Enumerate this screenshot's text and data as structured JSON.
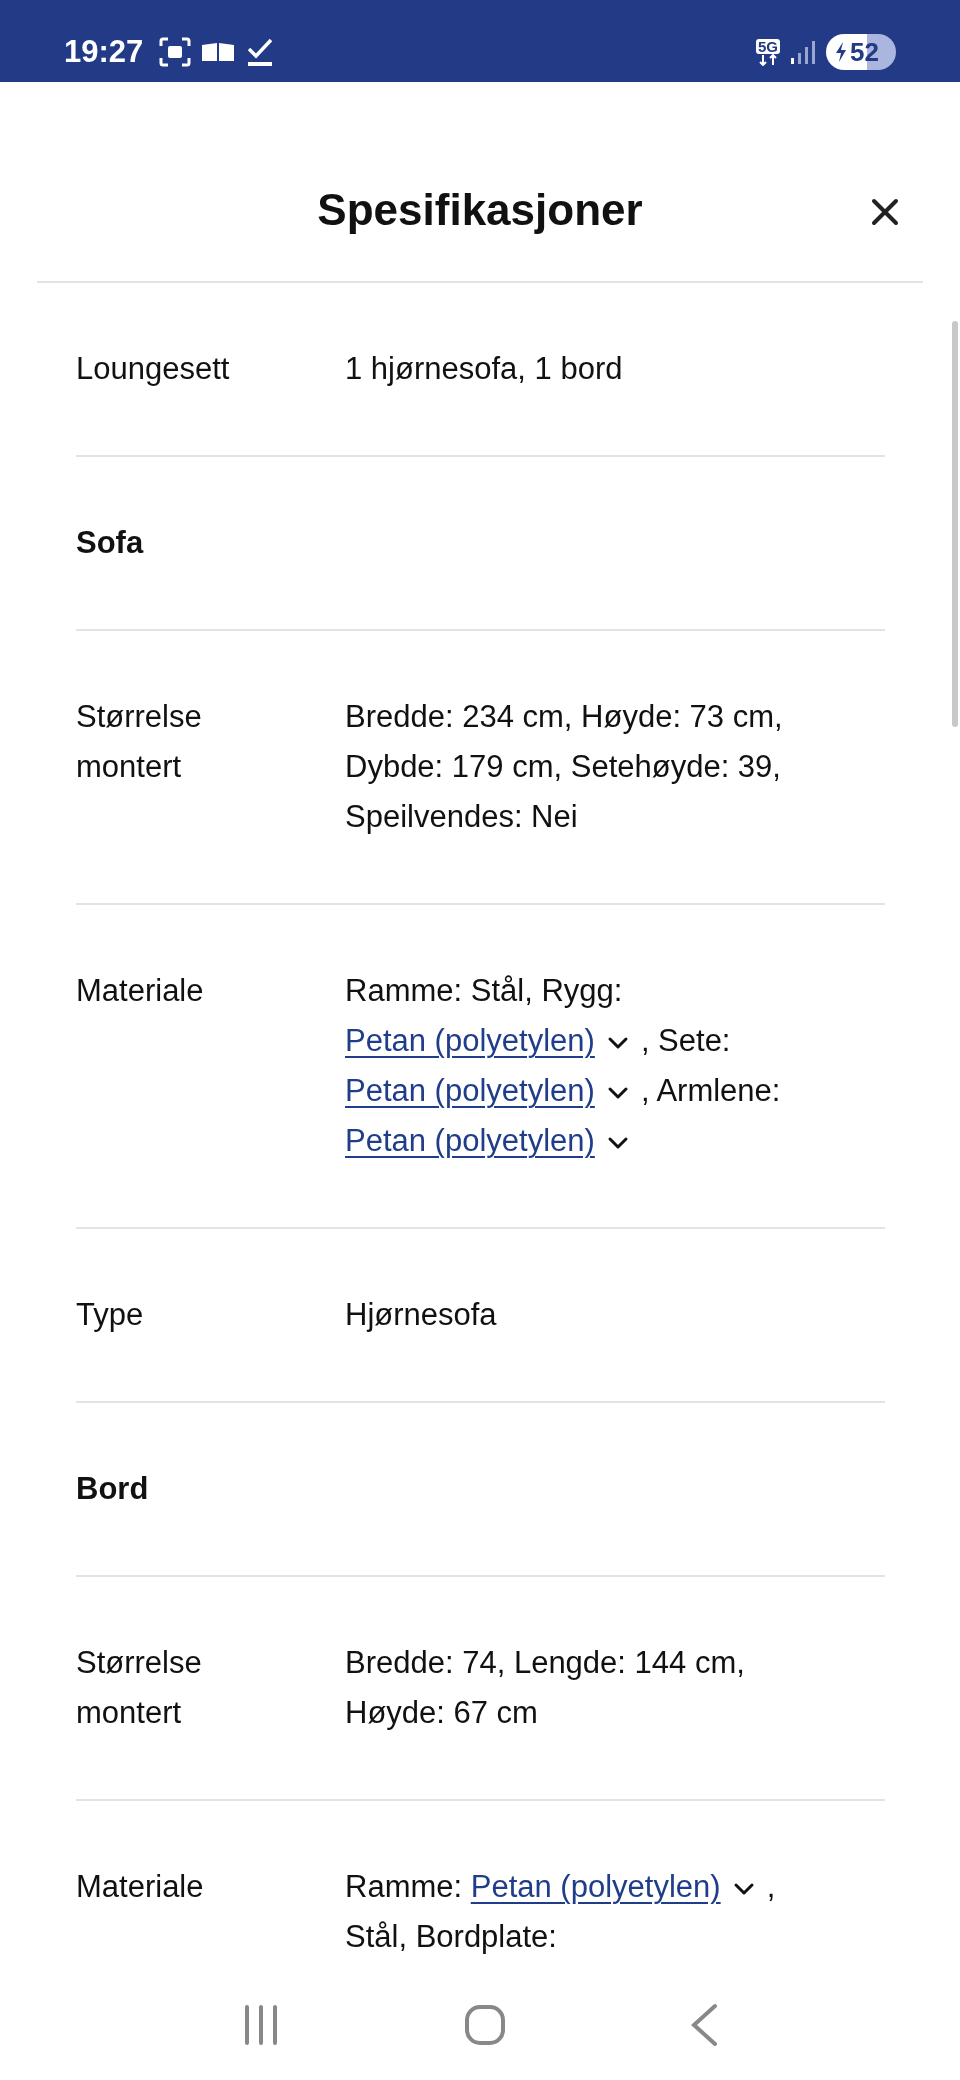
{
  "status_bar": {
    "time": "19:27",
    "network": "5G",
    "battery": "52"
  },
  "dialog": {
    "title": "Spesifikasjoner"
  },
  "rows": [
    {
      "kind": "pair",
      "label": [
        "Loungesett"
      ],
      "lines": [
        [
          {
            "kind": "text",
            "text": "1 hjørnesofa, 1 bord"
          }
        ]
      ]
    },
    {
      "kind": "section",
      "label": [
        "Sofa"
      ]
    },
    {
      "kind": "pair",
      "label": [
        "Størrelse",
        "montert"
      ],
      "lines": [
        [
          {
            "kind": "text",
            "text": "Bredde: 234 cm, Høyde: 73 cm,"
          }
        ],
        [
          {
            "kind": "text",
            "text": "Dybde: 179 cm, Setehøyde: 39,"
          }
        ],
        [
          {
            "kind": "text",
            "text": "Speilvendes: Nei"
          }
        ]
      ]
    },
    {
      "kind": "pair",
      "label": [
        "Materiale"
      ],
      "lines": [
        [
          {
            "kind": "text",
            "text": "Ramme: Stål, Rygg:"
          }
        ],
        [
          {
            "kind": "link",
            "text": "Petan (polyetylen)"
          },
          {
            "kind": "text",
            "text": ", Sete:"
          }
        ],
        [
          {
            "kind": "link",
            "text": "Petan (polyetylen)"
          },
          {
            "kind": "text",
            "text": ", Armlene:"
          }
        ],
        [
          {
            "kind": "link",
            "text": "Petan (polyetylen)"
          }
        ]
      ]
    },
    {
      "kind": "pair",
      "label": [
        "Type"
      ],
      "lines": [
        [
          {
            "kind": "text",
            "text": "Hjørnesofa"
          }
        ]
      ]
    },
    {
      "kind": "section",
      "label": [
        "Bord"
      ]
    },
    {
      "kind": "pair",
      "label": [
        "Størrelse",
        "montert"
      ],
      "lines": [
        [
          {
            "kind": "text",
            "text": "Bredde: 74, Lengde: 144 cm,"
          }
        ],
        [
          {
            "kind": "text",
            "text": "Høyde: 67 cm"
          }
        ]
      ]
    },
    {
      "kind": "pair",
      "label": [
        "Materiale"
      ],
      "lines": [
        [
          {
            "kind": "text",
            "text": "Ramme: "
          },
          {
            "kind": "link",
            "text": "Petan (polyetylen)"
          },
          {
            "kind": "text",
            "text": ","
          }
        ],
        [
          {
            "kind": "text",
            "text": "Stål, Bordplate:"
          }
        ]
      ]
    }
  ]
}
